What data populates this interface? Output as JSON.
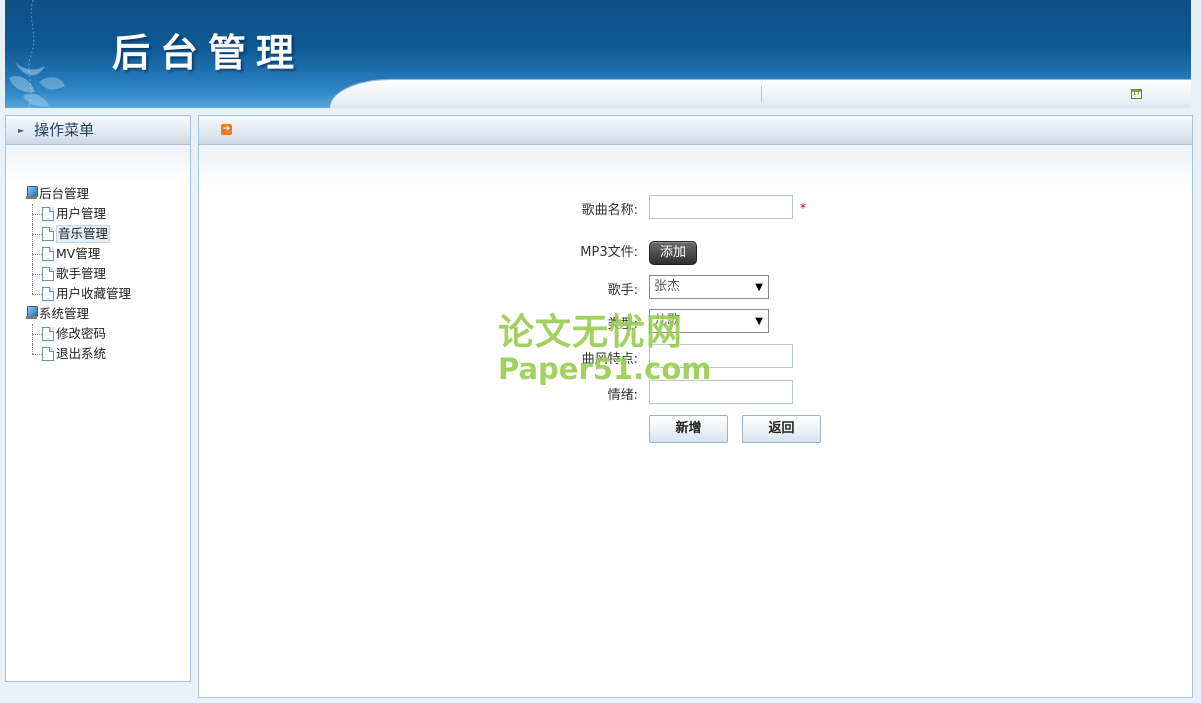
{
  "header": {
    "title": "后台管理",
    "calendar_icon_text": "17"
  },
  "sidebar": {
    "heading": "操作菜单",
    "groups": [
      {
        "label": "后台管理",
        "items": [
          "用户管理",
          "音乐管理",
          "MV管理",
          "歌手管理",
          "用户收藏管理"
        ]
      },
      {
        "label": "系统管理",
        "items": [
          "修改密码",
          "退出系统"
        ]
      }
    ],
    "selected_item": "音乐管理"
  },
  "form": {
    "song_name_label": "歌曲名称:",
    "song_name_value": "",
    "required_mark": "*",
    "mp3_label": "MP3文件:",
    "add_button": "添加",
    "singer_label": "歌手:",
    "singer_value": "张杰",
    "type_label": "类型:",
    "type_value": "儿歌",
    "style_label": "曲风特点:",
    "style_value": "",
    "mood_label": "情绪:",
    "mood_value": "",
    "submit_button": "新增",
    "back_button": "返回"
  },
  "watermark": {
    "line1": "论文无忧网",
    "line2": "Paper51.com"
  },
  "colors": {
    "header_dark": "#0f4f86",
    "header_light": "#5aa8dc",
    "border": "#a8c3da",
    "required": "#c00000",
    "watermark": "#86c432"
  }
}
